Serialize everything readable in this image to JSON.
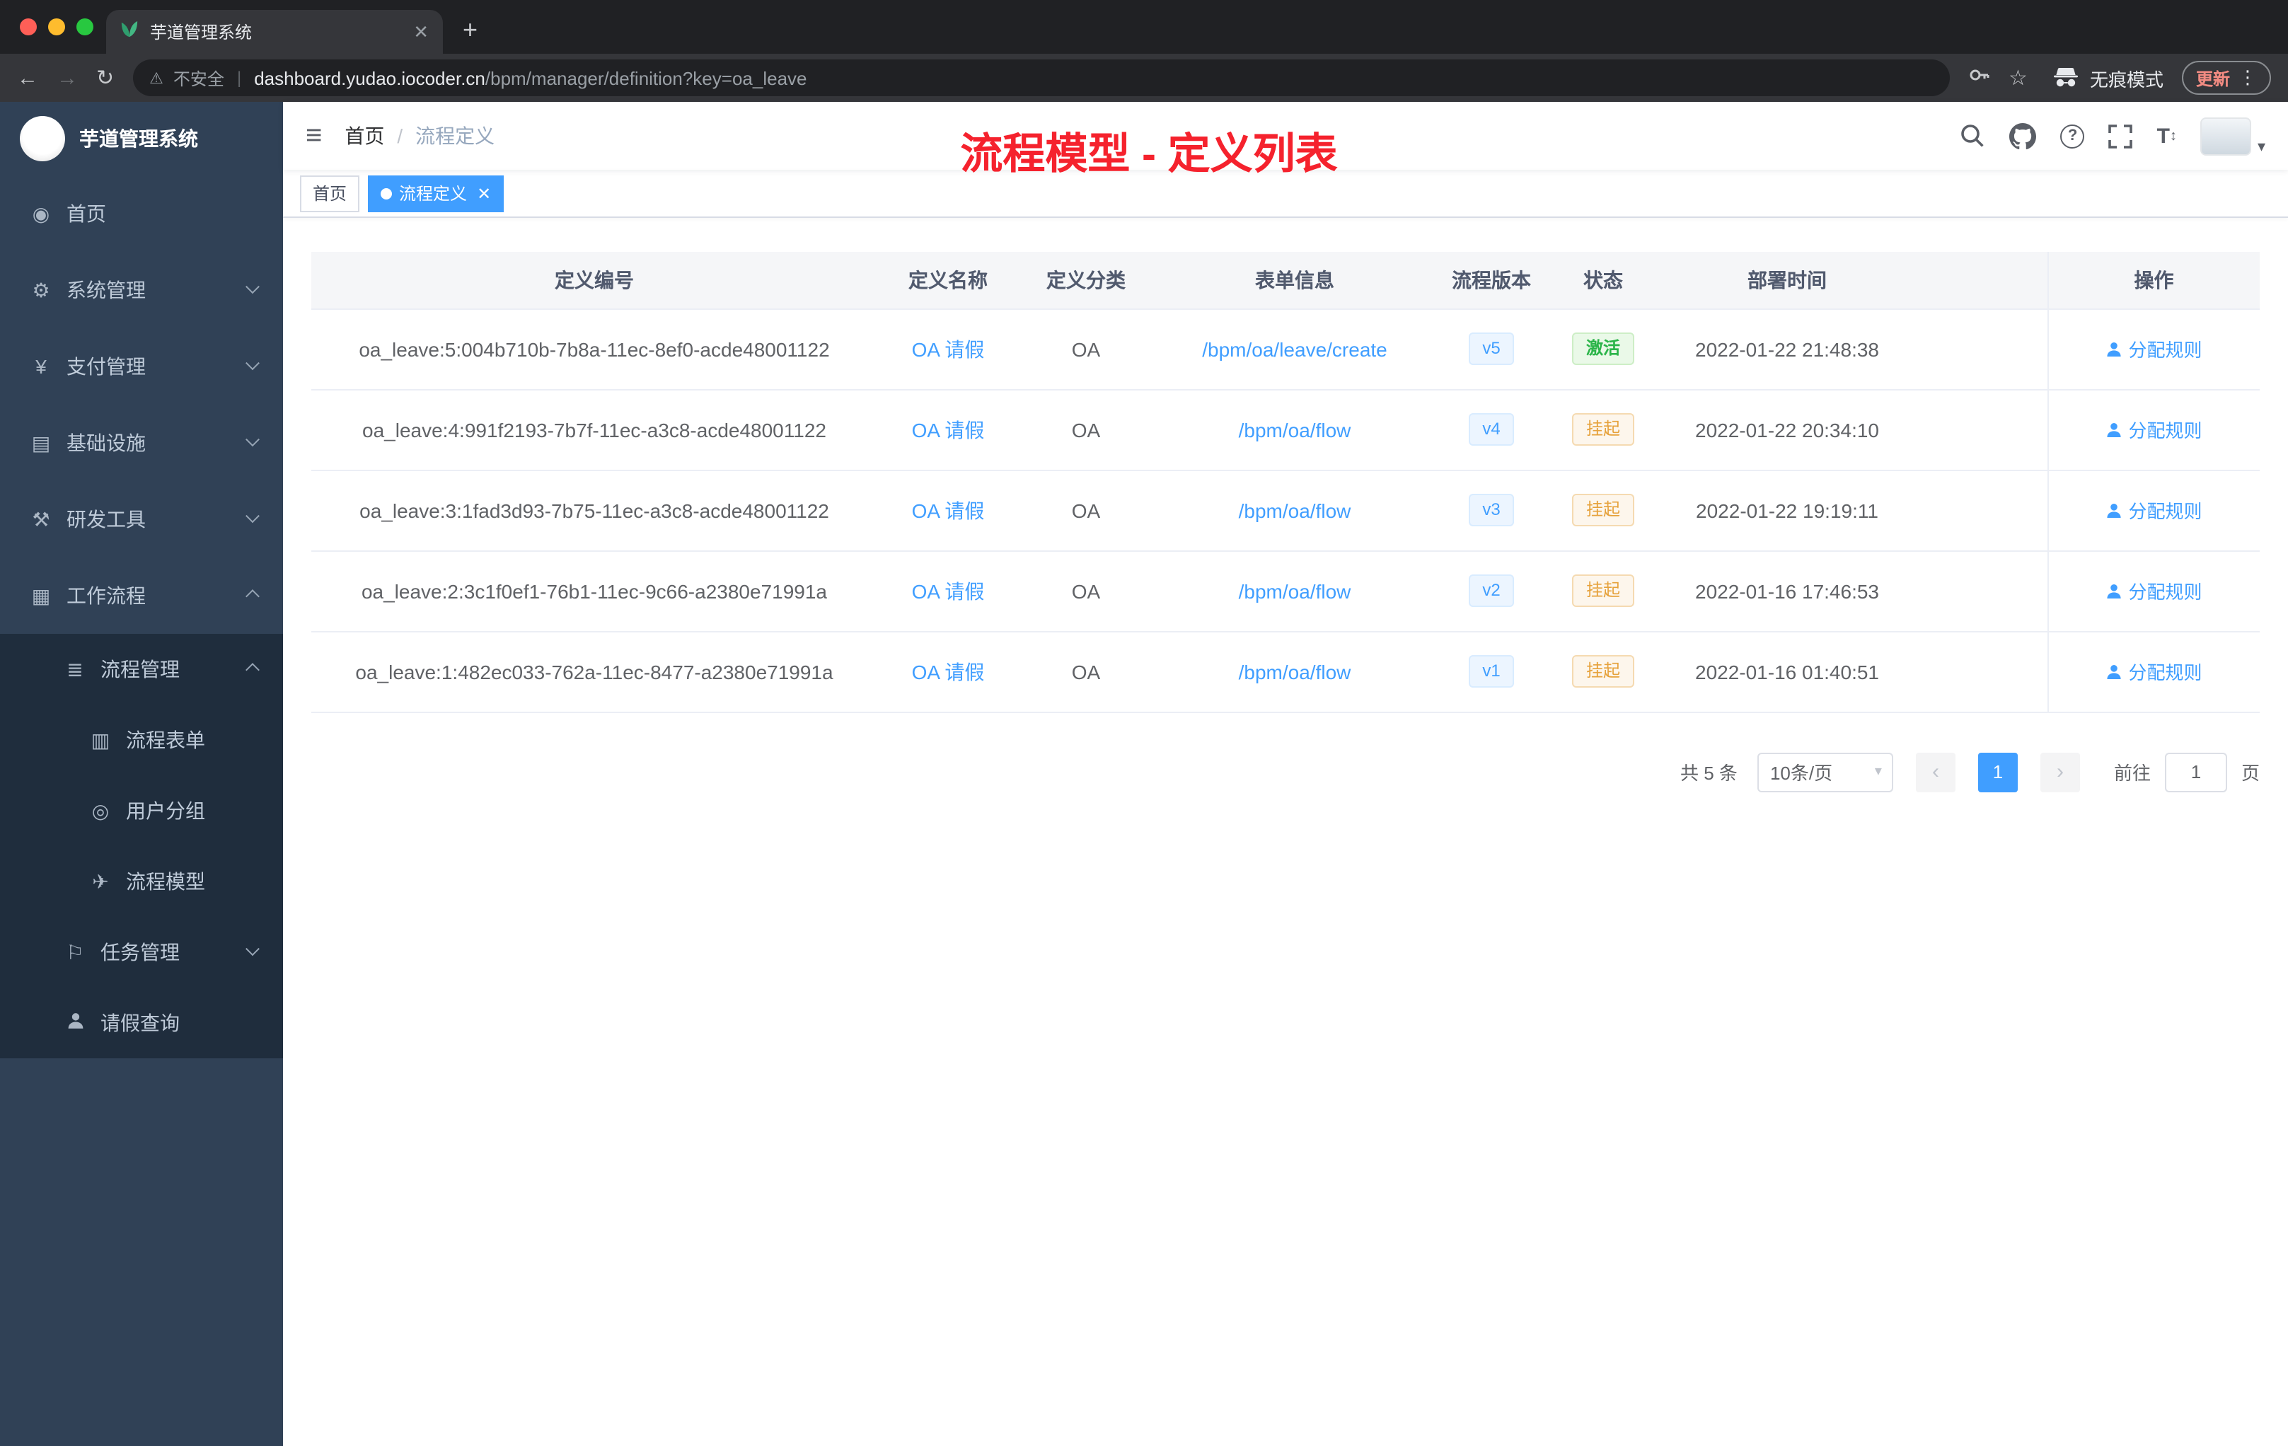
{
  "browser": {
    "tab_title": "芋道管理系统",
    "security_label": "不安全",
    "url_domain": "dashboard.yudao.iocoder.cn",
    "url_path": "/bpm/manager/definition?key=oa_leave",
    "incognito_label": "无痕模式",
    "update_label": "更新"
  },
  "sidebar": {
    "app_title": "芋道管理系统",
    "items": [
      {
        "label": "首页"
      },
      {
        "label": "系统管理"
      },
      {
        "label": "支付管理"
      },
      {
        "label": "基础设施"
      },
      {
        "label": "研发工具"
      },
      {
        "label": "工作流程"
      },
      {
        "label": "流程管理"
      },
      {
        "label": "流程表单"
      },
      {
        "label": "用户分组"
      },
      {
        "label": "流程模型"
      },
      {
        "label": "任务管理"
      },
      {
        "label": "请假查询"
      }
    ]
  },
  "header": {
    "breadcrumb": {
      "home": "首页",
      "current": "流程定义"
    },
    "annotation": "流程模型 - 定义列表"
  },
  "tags": {
    "items": [
      {
        "label": "首页",
        "active": false
      },
      {
        "label": "流程定义",
        "active": true
      }
    ]
  },
  "table": {
    "headers": [
      "定义编号",
      "定义名称",
      "定义分类",
      "表单信息",
      "流程版本",
      "状态",
      "部署时间",
      "操作"
    ],
    "rows": [
      {
        "id": "oa_leave:5:004b710b-7b8a-11ec-8ef0-acde48001122",
        "name": "OA 请假",
        "category": "OA",
        "form": "/bpm/oa/leave/create",
        "version": "v5",
        "status": "激活",
        "status_type": "success",
        "time": "2022-01-22 21:48:38",
        "action": "分配规则"
      },
      {
        "id": "oa_leave:4:991f2193-7b7f-11ec-a3c8-acde48001122",
        "name": "OA 请假",
        "category": "OA",
        "form": "/bpm/oa/flow",
        "version": "v4",
        "status": "挂起",
        "status_type": "warning",
        "time": "2022-01-22 20:34:10",
        "action": "分配规则"
      },
      {
        "id": "oa_leave:3:1fad3d93-7b75-11ec-a3c8-acde48001122",
        "name": "OA 请假",
        "category": "OA",
        "form": "/bpm/oa/flow",
        "version": "v3",
        "status": "挂起",
        "status_type": "warning",
        "time": "2022-01-22 19:19:11",
        "action": "分配规则"
      },
      {
        "id": "oa_leave:2:3c1f0ef1-76b1-11ec-9c66-a2380e71991a",
        "name": "OA 请假",
        "category": "OA",
        "form": "/bpm/oa/flow",
        "version": "v2",
        "status": "挂起",
        "status_type": "warning",
        "time": "2022-01-16 17:46:53",
        "action": "分配规则"
      },
      {
        "id": "oa_leave:1:482ec033-762a-11ec-8477-a2380e71991a",
        "name": "OA 请假",
        "category": "OA",
        "form": "/bpm/oa/flow",
        "version": "v1",
        "status": "挂起",
        "status_type": "warning",
        "time": "2022-01-16 01:40:51",
        "action": "分配规则"
      }
    ]
  },
  "pagination": {
    "total": "共 5 条",
    "page_size": "10条/页",
    "current_page": "1",
    "goto_label": "前往",
    "goto_value": "1",
    "page_unit": "页"
  },
  "colors": {
    "accent": "#409eff",
    "success": "#2cb54a",
    "warning": "#e6a23c",
    "annotation_red": "#f5222d",
    "sidebar_bg": "#304156",
    "submenu_bg": "#1f2d3d"
  }
}
